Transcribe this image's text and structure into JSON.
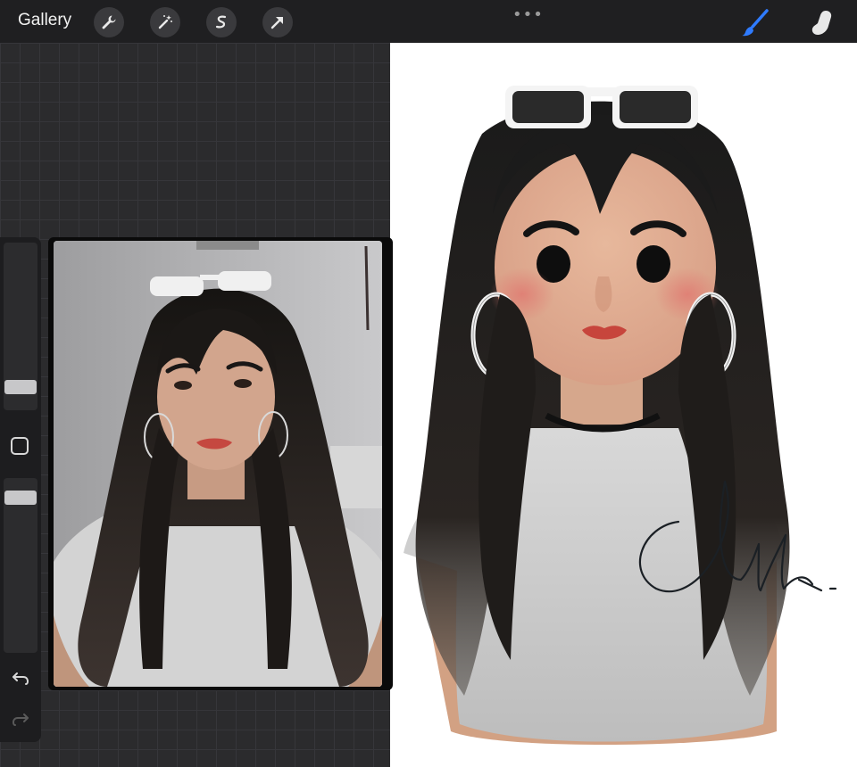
{
  "toolbar": {
    "gallery_label": "Gallery",
    "tools": [
      {
        "name": "actions",
        "icon": "wrench-icon"
      },
      {
        "name": "adjustments",
        "icon": "magic-wand-icon"
      },
      {
        "name": "selection",
        "icon": "selection-s-icon"
      },
      {
        "name": "transform",
        "icon": "arrow-cursor-icon"
      }
    ],
    "more_label": "•••",
    "paint_tool": {
      "icon": "brush-icon",
      "active": true,
      "color": "#2f7bff"
    },
    "smudge_tool": {
      "icon": "smudge-finger-icon",
      "active": false
    }
  },
  "sidebar": {
    "brush_size_level": 0.3,
    "opacity_level": 0.25,
    "modify_button": "square-icon",
    "undo": "undo-icon",
    "redo": "redo-icon"
  },
  "reference_window": {
    "content": "reference-photo"
  },
  "canvas": {
    "content": "cartoon-portrait-illustration",
    "signature_glyph": "signature"
  }
}
